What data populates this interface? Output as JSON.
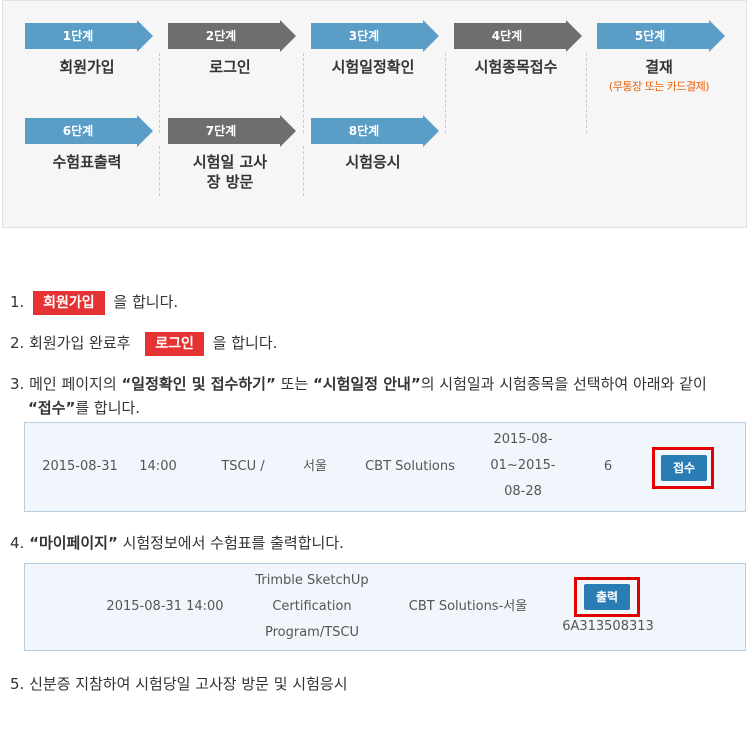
{
  "steps": [
    {
      "badge": "1단계",
      "name": "회원가입",
      "sub": ""
    },
    {
      "badge": "2단계",
      "name": "로그인",
      "sub": ""
    },
    {
      "badge": "3단계",
      "name": "시험일정확인",
      "sub": ""
    },
    {
      "badge": "4단계",
      "name": "시험종목접수",
      "sub": ""
    },
    {
      "badge": "5단계",
      "name": "결재",
      "sub": "(무통장 또는 카드결제)"
    },
    {
      "badge": "6단계",
      "name": "수험표출력",
      "sub": ""
    },
    {
      "badge": "7단계",
      "name": "시험일 고사장 방문",
      "sub": ""
    },
    {
      "badge": "8단계",
      "name": "시험응시",
      "sub": ""
    }
  ],
  "instructions": {
    "i1": {
      "num": "1.",
      "badge": "회원가입",
      "after": "을 합니다."
    },
    "i2": {
      "num": "2.",
      "before": "회원가입 완료후",
      "badge": "로그인",
      "after": "을 합니다."
    },
    "i3": {
      "num": "3.",
      "t1": "메인 페이지의 ",
      "q1": "“일정확인 및 접수하기”",
      "t2": " 또는 ",
      "q2": "“시험일정 안내”",
      "t3": "의 시험일과 시험종목을 선택하여 아래와 같이",
      "q3": "“접수”",
      "t4": "를 합니다."
    },
    "i4": {
      "num": "4.",
      "q1": "“마이페이지”",
      "t1": " 시험정보에서 수험표를 출력합니다."
    },
    "i5": {
      "num": "5.",
      "text": "신분증 지참하여 시험당일 고사장 방문 및 시험응시"
    }
  },
  "exam_row": {
    "date": "2015-08-31",
    "time": "14:00",
    "org": "TSCU /",
    "city": "서울",
    "center": "CBT Solutions",
    "period_line1": "2015-08-",
    "period_line2": "01~2015-",
    "period_line3": "08-28",
    "seats": "6",
    "button": "접수"
  },
  "ticket_row": {
    "datetime": "2015-08-31 14:00",
    "program_line1": "Trimble SketchUp",
    "program_line2": "Certification",
    "program_line3": "Program/TSCU",
    "center": "CBT Solutions-서울",
    "button": "출력",
    "code": "6A313508313"
  }
}
